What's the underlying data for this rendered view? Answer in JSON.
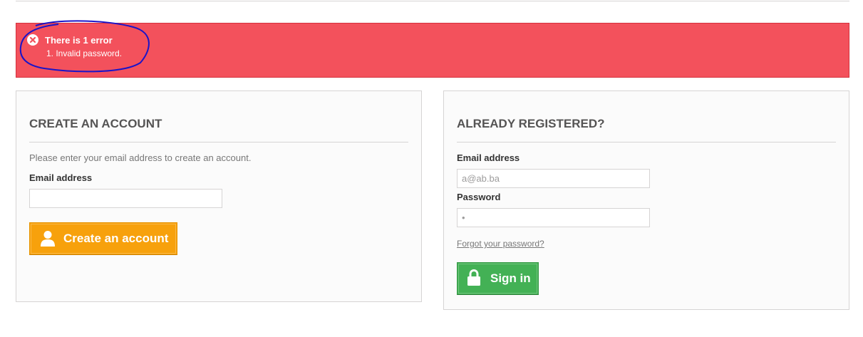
{
  "error": {
    "title": "There is 1 error",
    "items": [
      "1. Invalid password."
    ]
  },
  "create_account": {
    "heading": "CREATE AN ACCOUNT",
    "intro": "Please enter your email address to create an account.",
    "email_label": "Email address",
    "email_value": "",
    "button_label": "Create an account"
  },
  "login": {
    "heading": "ALREADY REGISTERED?",
    "email_label": "Email address",
    "email_value": "a@ab.ba",
    "password_label": "Password",
    "password_value": "•",
    "forgot_label": "Forgot your password?",
    "button_label": "Sign in"
  },
  "colors": {
    "error_bg": "#f3515c",
    "create_button": "#f7a10c",
    "signin_button": "#43b155",
    "annotation_stroke": "#1a14c8"
  },
  "icons": {
    "error": "close-circle-icon",
    "create": "user-icon",
    "signin": "lock-icon"
  }
}
